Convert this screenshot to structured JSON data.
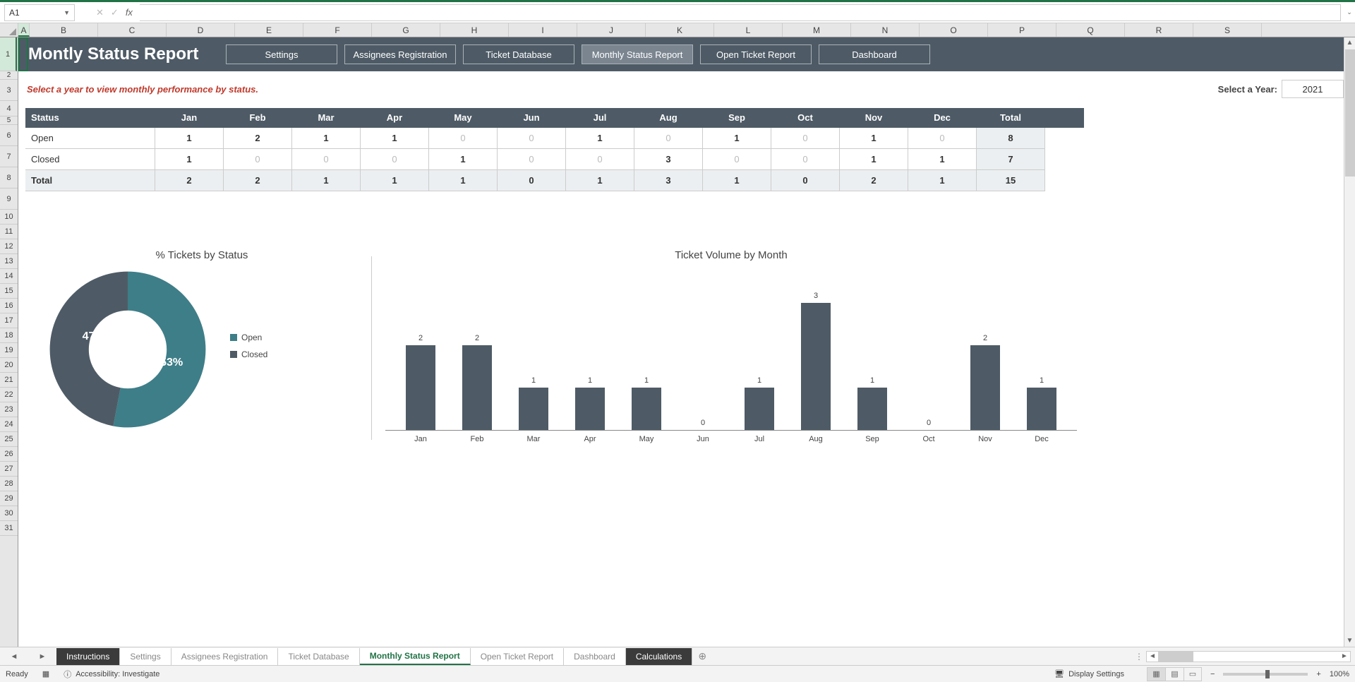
{
  "formula_bar": {
    "name_box": "A1",
    "fx_label": "fx",
    "formula": ""
  },
  "columns": [
    "A",
    "B",
    "C",
    "D",
    "E",
    "F",
    "G",
    "H",
    "I",
    "J",
    "K",
    "L",
    "M",
    "N",
    "O",
    "P",
    "Q",
    "R",
    "S"
  ],
  "report": {
    "title": "Montly Status Report",
    "nav": [
      "Settings",
      "Assignees Registration",
      "Ticket Database",
      "Monthly Status Report",
      "Open Ticket Report",
      "Dashboard"
    ],
    "nav_active_idx": 3,
    "instruction": "Select a year to view monthly performance by status.",
    "year_label": "Select a Year:",
    "year_value": "2021"
  },
  "table": {
    "headers": [
      "Status",
      "Jan",
      "Feb",
      "Mar",
      "Apr",
      "May",
      "Jun",
      "Jul",
      "Aug",
      "Sep",
      "Oct",
      "Nov",
      "Dec",
      "Total"
    ],
    "rows": [
      {
        "label": "Open",
        "values": [
          1,
          2,
          1,
          1,
          0,
          0,
          1,
          0,
          1,
          0,
          1,
          0
        ],
        "total": 8
      },
      {
        "label": "Closed",
        "values": [
          1,
          0,
          0,
          0,
          1,
          0,
          0,
          3,
          0,
          0,
          1,
          1
        ],
        "total": 7
      }
    ],
    "total_row": {
      "label": "Total",
      "values": [
        2,
        2,
        1,
        1,
        1,
        0,
        1,
        3,
        1,
        0,
        2,
        1
      ],
      "total": 15
    }
  },
  "pie_chart": {
    "title": "% Tickets by Status",
    "legend": [
      {
        "label": "Open",
        "color": "#3e7e88"
      },
      {
        "label": "Closed",
        "color": "#4e5b66"
      }
    ],
    "open_pct": "53%",
    "closed_pct": "47%"
  },
  "bar_chart": {
    "title": "Ticket Volume by Month"
  },
  "chart_data": [
    {
      "type": "pie",
      "title": "% Tickets by Status",
      "slices": [
        {
          "name": "Open",
          "value": 53,
          "color": "#3e7e88"
        },
        {
          "name": "Closed",
          "value": 47,
          "color": "#4e5b66"
        }
      ],
      "hole": 0.55
    },
    {
      "type": "bar",
      "title": "Ticket Volume by Month",
      "categories": [
        "Jan",
        "Feb",
        "Mar",
        "Apr",
        "May",
        "Jun",
        "Jul",
        "Aug",
        "Sep",
        "Oct",
        "Nov",
        "Dec"
      ],
      "values": [
        2,
        2,
        1,
        1,
        1,
        0,
        1,
        3,
        1,
        0,
        2,
        1
      ],
      "ylim": [
        0,
        3
      ],
      "color": "#4e5b66",
      "xlabel": "",
      "ylabel": ""
    }
  ],
  "tabs": {
    "items": [
      {
        "label": "Instructions",
        "style": "dark"
      },
      {
        "label": "Settings",
        "style": "other"
      },
      {
        "label": "Assignees Registration",
        "style": "other"
      },
      {
        "label": "Ticket Database",
        "style": "other"
      },
      {
        "label": "Monthly Status Report",
        "style": "active"
      },
      {
        "label": "Open Ticket Report",
        "style": "other"
      },
      {
        "label": "Dashboard",
        "style": "other"
      },
      {
        "label": "Calculations",
        "style": "dark"
      }
    ]
  },
  "status": {
    "ready": "Ready",
    "accessibility": "Accessibility: Investigate",
    "display_settings": "Display Settings",
    "zoom": "100%"
  }
}
